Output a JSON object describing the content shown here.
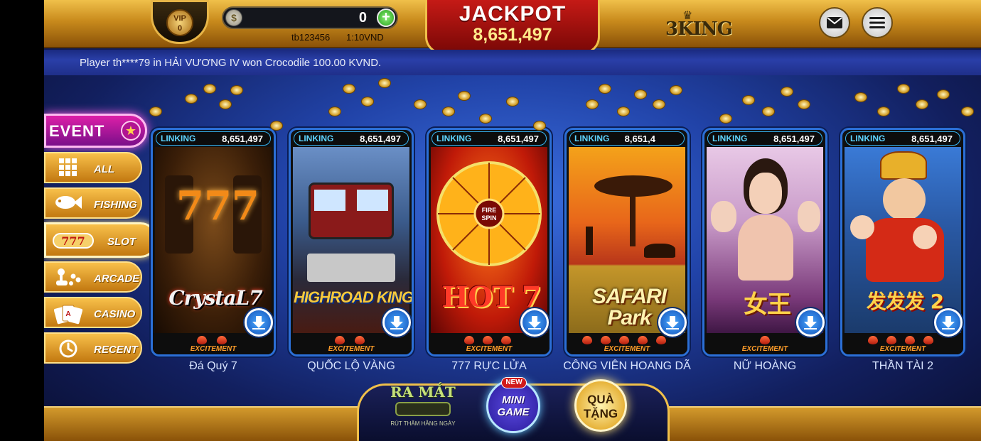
{
  "header": {
    "vip_label": "VIP",
    "vip_level": "0",
    "balance": "0",
    "user_id": "tb123456",
    "rate": "1:10VND",
    "jackpot_title": "JACKPOT",
    "jackpot_value": "8,651,497",
    "logo_text": "3KING"
  },
  "icons": {
    "coin": "coin-icon",
    "add": "plus-icon",
    "mail": "mail-icon",
    "menu": "hamburger-menu-icon",
    "download": "download-arrow-icon"
  },
  "ticker": {
    "text": "Player th****79 in  HẢI VƯƠNG IV  won  Crocodile 100.00 KVND."
  },
  "sidebar": {
    "event_label": "EVENT",
    "categories": [
      {
        "label": "ALL",
        "icon": "grid-icon"
      },
      {
        "label": "FISHING",
        "icon": "fish-icon"
      },
      {
        "label": "SLOT",
        "icon": "slot-777-icon",
        "active": true
      },
      {
        "label": "ARCADE",
        "icon": "joystick-icon"
      },
      {
        "label": "CASINO",
        "icon": "cards-icon"
      },
      {
        "label": "RECENT",
        "icon": "clock-icon"
      }
    ]
  },
  "games": [
    {
      "linking_label": "LINKING",
      "linking_value": "8,651,497",
      "title_art": "CrystaL7",
      "name": "Đá Quý 7",
      "excitement": "EXCITEMENT",
      "heat": 2
    },
    {
      "linking_label": "LINKING",
      "linking_value": "8,651,497",
      "title_art": "HIGHROAD KING",
      "name": "QUỐC LỘ VÀNG",
      "excitement": "EXCITEMENT",
      "heat": 2
    },
    {
      "linking_label": "LINKING",
      "linking_value": "8,651,497",
      "title_art": "HOT 7",
      "name": "777 RỰC LỬA",
      "excitement": "EXCITEMENT",
      "heat": 3
    },
    {
      "linking_label": "LINKING",
      "linking_value": "8,651,4",
      "title_art": "SAFARI Park",
      "name": "CÔNG VIÊN HOANG DÃ",
      "excitement": "EXCITEMENT",
      "heat": 5
    },
    {
      "linking_label": "LINKING",
      "linking_value": "8,651,497",
      "title_art": "女王",
      "name": "NỮ HOÀNG",
      "excitement": "EXCITEMENT",
      "heat": 1
    },
    {
      "linking_label": "LINKING",
      "linking_value": "8,651,497",
      "title_art": "发发发 2",
      "name": "THẦN TÀI 2",
      "excitement": "EXCITEMENT",
      "heat": 4
    }
  ],
  "bottom": {
    "ramat_title": "RA MẮT",
    "ramat_sub": "RÚT THĂM HẰNG NGÀY",
    "new_badge": "NEW",
    "minigame_label": "MINI GAME",
    "quatang_label": "QUÀ TẶNG"
  },
  "colors": {
    "gold": "#f0c04a",
    "jackpot_red": "#c51a16",
    "card_border": "#2b6fd6",
    "linking_cyan": "#5fd4ff",
    "event_magenta": "#dd1fa8"
  }
}
